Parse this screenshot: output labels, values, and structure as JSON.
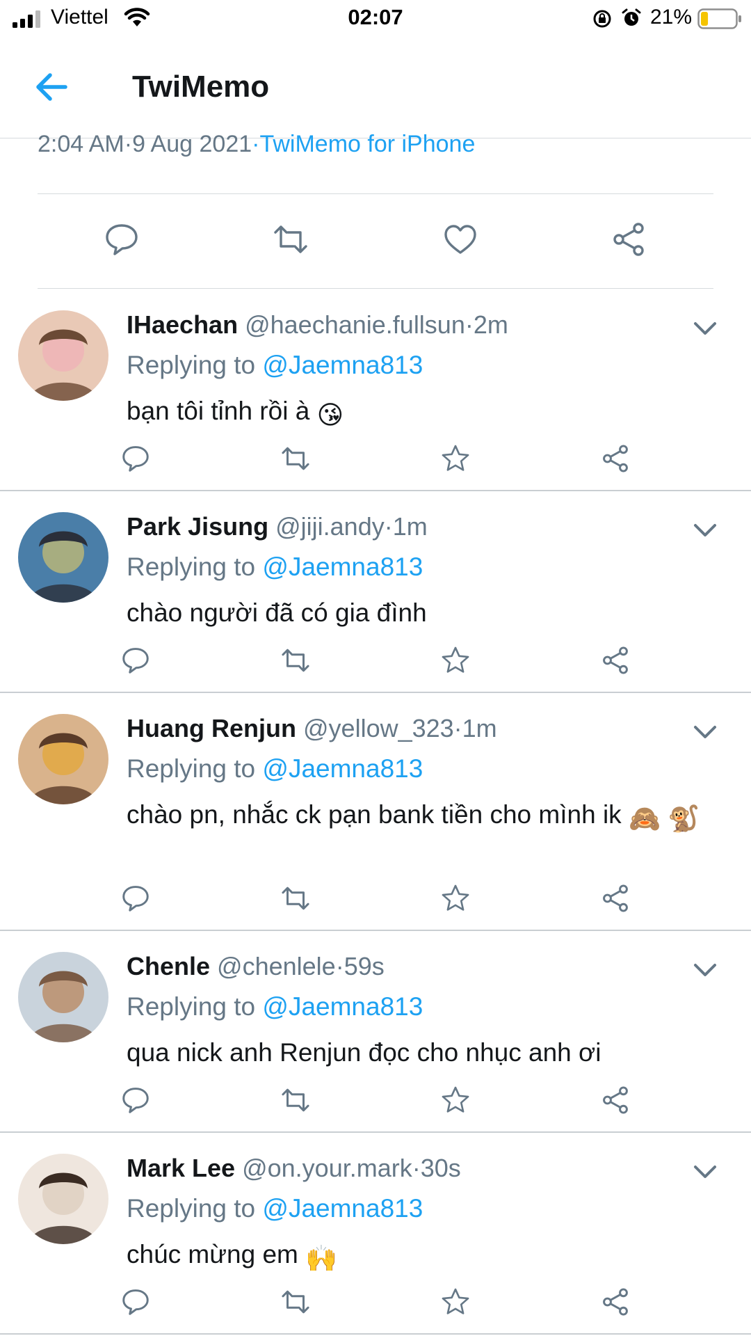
{
  "status_bar": {
    "carrier": "Viettel",
    "time": "02:07",
    "battery_percent": "21%",
    "battery_level": 0.21,
    "icons": [
      "signal-icon",
      "wifi-icon",
      "rotation-lock-icon",
      "alarm-icon",
      "battery-icon"
    ]
  },
  "nav": {
    "title": "TwiMemo",
    "back_icon": "arrow-left-icon"
  },
  "tweet_meta": {
    "time": "2:04 AM",
    "sep1": "·",
    "date": "9 Aug 2021",
    "sep2": "·",
    "source": "TwiMemo for iPhone"
  },
  "main_actions": [
    "comment-icon",
    "retweet-icon",
    "heart-icon",
    "share-icon"
  ],
  "replies": [
    {
      "name": "IHaechan",
      "handle": "@haechanie.fullsun",
      "time": "·2m",
      "replying_label": "Replying to",
      "mention": "@Jaemna813",
      "text": "bạn tôi tỉnh rồi à",
      "emoji": "😘"
    },
    {
      "name": "Park Jisung",
      "handle": "@jiji.andy",
      "time": "·1m",
      "replying_label": "Replying to",
      "mention": "@Jaemna813",
      "text": "chào người đã có gia đình",
      "emoji": ""
    },
    {
      "name": "Huang Renjun",
      "handle": "@yellow_323",
      "time": "·1m",
      "replying_label": "Replying to",
      "mention": "@Jaemna813",
      "text": "chào pn, nhắc ck pạn bank tiền cho mình ik",
      "emoji": "🙈 🐒"
    },
    {
      "name": " Chenle",
      "handle": "@chenlele",
      "time": "·59s",
      "replying_label": "Replying to",
      "mention": "@Jaemna813",
      "text": "qua nick anh Renjun đọc cho nhục anh ơi",
      "emoji": ""
    },
    {
      "name": "Mark Lee",
      "handle": "@on.your.mark",
      "time": "·30s",
      "replying_label": "Replying to",
      "mention": "@Jaemna813",
      "text": "chúc mừng em",
      "emoji": "🙌"
    }
  ],
  "reply_actions": [
    "comment-icon",
    "retweet-icon",
    "star-icon",
    "share-icon"
  ],
  "colors": {
    "accent": "#1da1f2",
    "secondary_text": "#657786",
    "icon_gray": "#657786",
    "battery_low": "#f5c400"
  }
}
